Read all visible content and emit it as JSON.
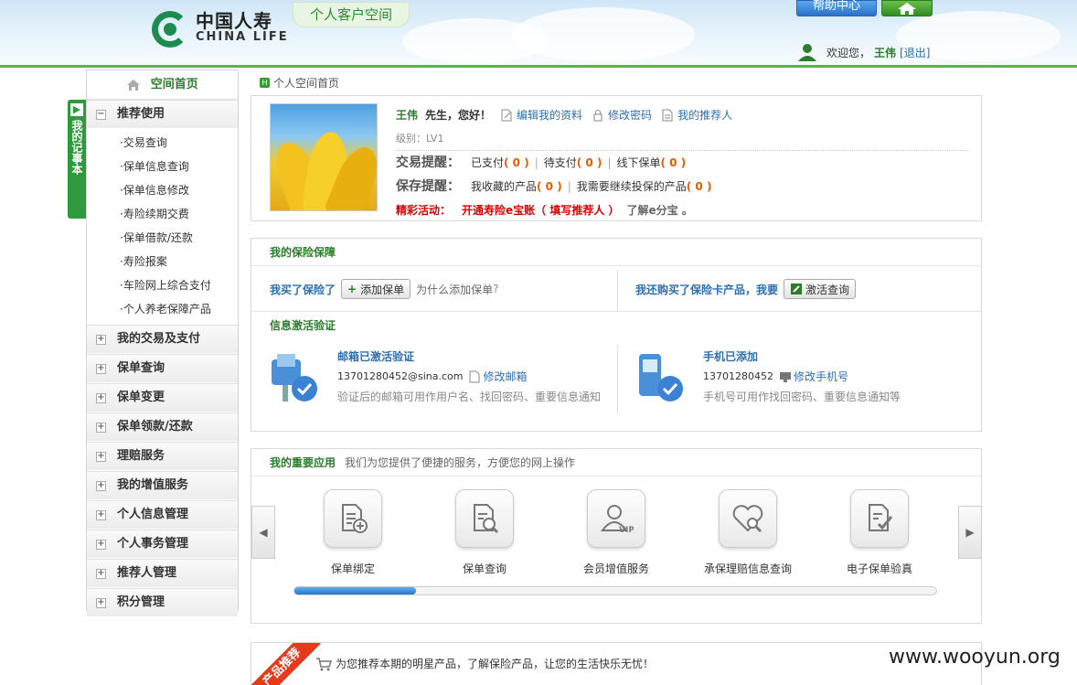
{
  "header": {
    "logo_cn": "中国人寿",
    "logo_en": "CHINA LIFE",
    "space_tag": "个人客户空间",
    "help_label": "帮助中心",
    "welcome_prefix": "欢迎您，",
    "user_name": "王伟",
    "logout_label": "[退出]"
  },
  "notebook": {
    "label": "我的记事本"
  },
  "sidebar": {
    "home_label": "空间首页",
    "expanded_group": "推荐使用",
    "sub_items": [
      "·交易查询",
      "·保单信息查询",
      "·保单信息修改",
      "·寿险续期交费",
      "·保单借款/还款",
      "·寿险报案",
      "·车险网上综合支付",
      "·个人养老保障产品"
    ],
    "groups": [
      "我的交易及支付",
      "保单查询",
      "保单变更",
      "保单领款/还款",
      "理赔服务",
      "我的增值服务",
      "个人信息管理",
      "个人事务管理",
      "推荐人管理",
      "积分管理"
    ]
  },
  "breadcrumb": {
    "label": "个人空间首页"
  },
  "profile": {
    "name": "王伟",
    "greeting": "先生，您好！",
    "edit_profile": "编辑我的资料",
    "change_password": "修改密码",
    "my_referrer": "我的推荐人",
    "level": "级别：LV1",
    "trade_label": "交易提醒：",
    "paid_label": "已支付",
    "paid_count": "( 0 )",
    "pending_label": "待支付",
    "pending_count": "( 0 )",
    "offline_label": "线下保单",
    "offline_count": "( 0 )",
    "save_label": "保存提醒：",
    "fav_label": "我收藏的产品",
    "fav_count": "( 0 )",
    "renew_label": "我需要继续投保的产品",
    "renew_count": "( 0 )",
    "promo_label": "精彩活动：",
    "promo_text": "开通寿险e宝账（ 填写推荐人 ）",
    "promo_link": "了解e分宝 。"
  },
  "insurance": {
    "title": "我的保险保障",
    "bought_label": "我买了保险了",
    "add_policy": "添加保单",
    "why_add": "为什么添加保单",
    "card_label": "我还购买了保险卡产品，我要",
    "activate_query": "激活查询",
    "verify_title": "信息激活验证",
    "email_title": "邮箱已激活验证",
    "email_value": "13701280452@sina.com",
    "email_edit": "修改邮箱",
    "email_note": "验证后的邮箱可用作用户名、找回密码、重要信息通知",
    "phone_title": "手机已添加",
    "phone_value": "13701280452",
    "phone_edit": "修改手机号",
    "phone_note": "手机号可用作找回密码、重要信息通知等"
  },
  "apps": {
    "title": "我的重要应用",
    "subtitle": "我们为您提供了便捷的服务，方便您的网上操作",
    "items": [
      {
        "label": "保单绑定",
        "icon": "policy-bind-icon"
      },
      {
        "label": "保单查询",
        "icon": "policy-search-icon"
      },
      {
        "label": "会员增值服务",
        "icon": "vip-member-icon"
      },
      {
        "label": "承保理赔信息查询",
        "icon": "claim-search-icon"
      },
      {
        "label": "电子保单验真",
        "icon": "policy-verify-icon"
      }
    ],
    "scroll_fraction": 0.19
  },
  "products": {
    "ribbon": "产品推荐",
    "text": "为您推荐本期的明星产品，了解保险产品，让您的生活快乐无忧！"
  },
  "watermark": "www.wooyun.org",
  "colors": {
    "brand_green": "#2a7d2a",
    "link_blue": "#2d6fb0",
    "alert_orange": "#e65c00",
    "alert_red": "#dd0000"
  }
}
